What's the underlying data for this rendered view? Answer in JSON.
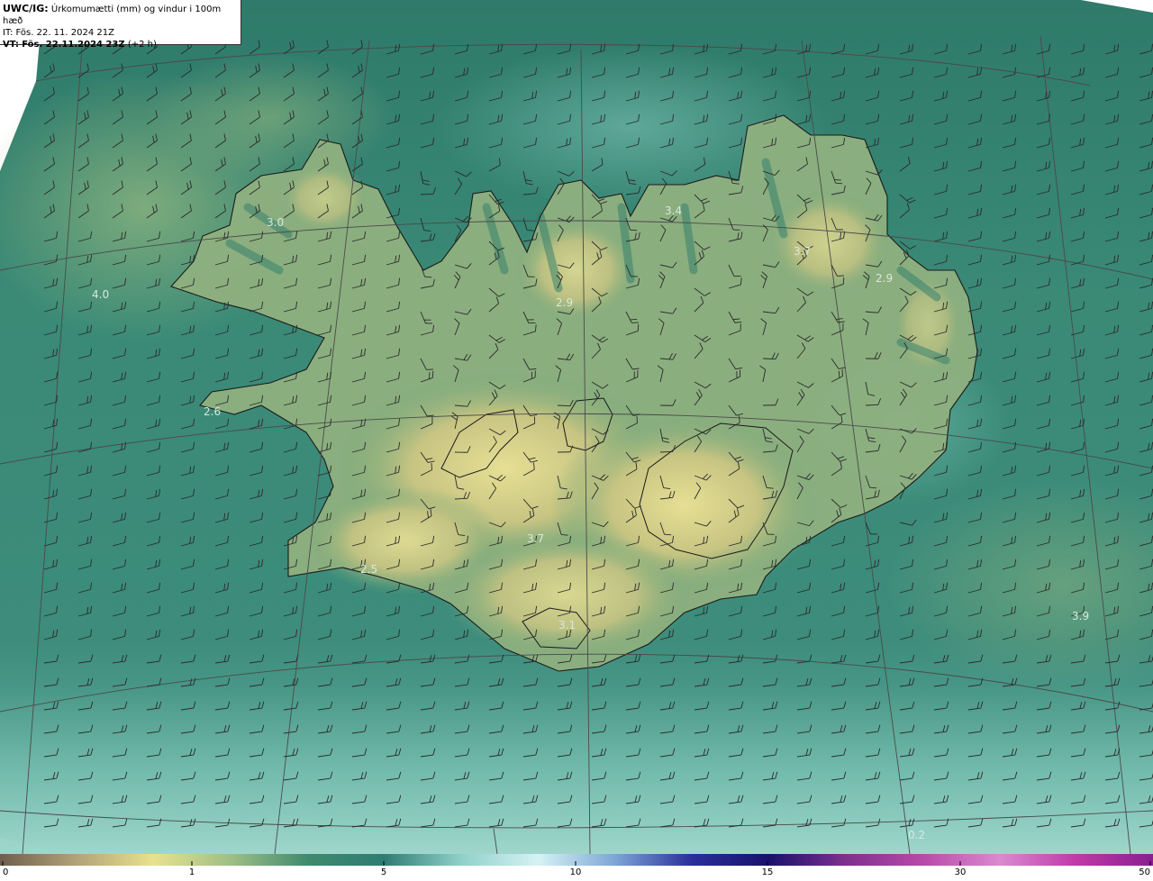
{
  "header": {
    "product_code": "UWC/IG:",
    "product_desc": "Úrkomumætti (mm) og vindur i 100m hæð",
    "initial_time": "IT: Fös. 22. 11. 2024 21Z",
    "valid_prefix": "VT:",
    "valid_time": "Fös. 22.11.2024 23Z",
    "valid_offset": "(+2 h)"
  },
  "value_labels": [
    "3.0",
    "4.0",
    "2.9",
    "3.7",
    "2.9",
    "3.4",
    "2.6",
    "3.7",
    "2.5",
    "3.1",
    "3.9",
    "0.2"
  ],
  "colorbar": {
    "ticks": [
      "0",
      "1",
      "5",
      "10",
      "15",
      "30",
      "50"
    ],
    "colors": [
      "#6e5f4e",
      "#b3a377",
      "#e8e28f",
      "#9fbf86",
      "#3f8a6e",
      "#2f7c74",
      "#8fd1c9",
      "#d6f2f5",
      "#7ea6d6",
      "#2a2f9a",
      "#18116b",
      "#7e2f8e",
      "#b84aa8",
      "#d98ad0",
      "#c03aa8",
      "#8a1f8f"
    ]
  },
  "colors": {
    "sea_base": "#3b8a78",
    "land_high": "#e1db8e",
    "graticule": "#4a4a4a",
    "coastline": "#1a1a1a",
    "barb": "#2a2a2a"
  }
}
